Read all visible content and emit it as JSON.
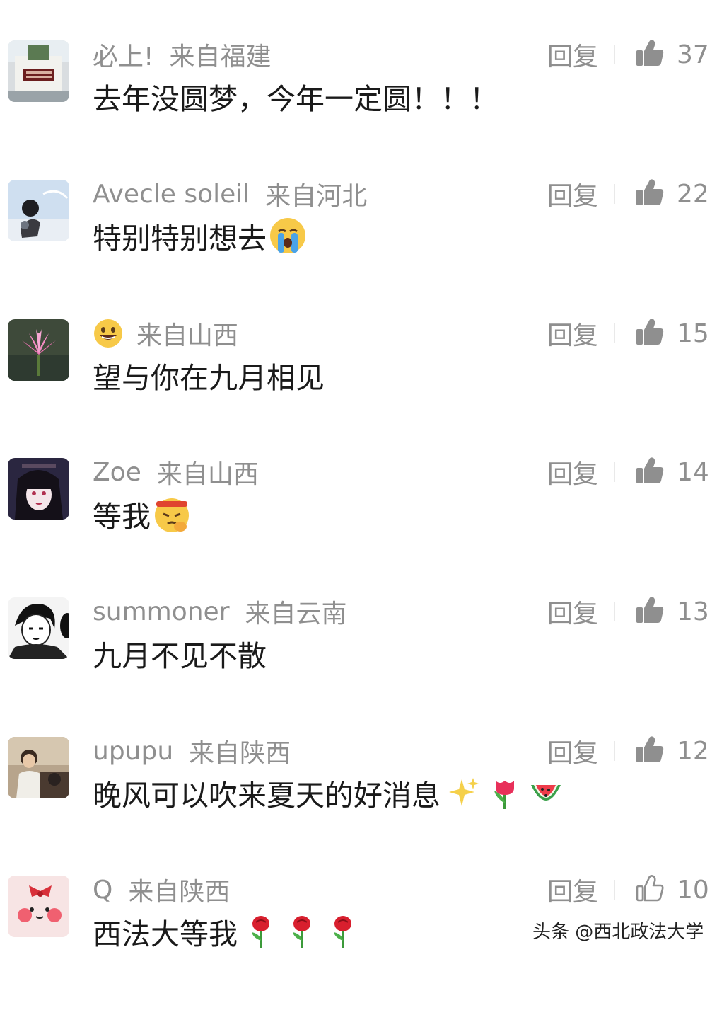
{
  "reply_label": "回复",
  "watermark": "头条 @西北政法大学",
  "comments": [
    {
      "user": "必上!",
      "location": "来自福建",
      "text": "去年没圆梦，今年一定圆！！！",
      "likes": "37",
      "avatar_icon": "building-photo-icon",
      "emojis": []
    },
    {
      "user": "Avecle soleil",
      "location": "来自河北",
      "text": "特别特别想去",
      "likes": "22",
      "avatar_icon": "sky-figure-photo-icon",
      "emojis": [
        "crying-face-emoji"
      ]
    },
    {
      "user": "",
      "location": "来自山西",
      "text": "望与你在九月相见",
      "likes": "15",
      "avatar_icon": "lotus-flower-photo-icon",
      "name_icon": "smiley-face-emoji",
      "emojis": []
    },
    {
      "user": "Zoe",
      "location": "来自山西",
      "text": "等我",
      "likes": "14",
      "avatar_icon": "anime-girl-avatar-icon",
      "emojis": [
        "determined-face-emoji"
      ]
    },
    {
      "user": "summoner",
      "location": "来自云南",
      "text": "九月不见不散",
      "likes": "13",
      "avatar_icon": "manga-boy-avatar-icon",
      "emojis": []
    },
    {
      "user": "upupu",
      "location": "来自陕西",
      "text": "晚风可以吹来夏天的好消息",
      "likes": "12",
      "avatar_icon": "person-photo-icon",
      "emojis": [
        "sparkles-emoji",
        "tulip-emoji",
        "watermelon-emoji"
      ]
    },
    {
      "user": "Q",
      "location": "来自陕西",
      "text": "西法大等我",
      "likes": "10",
      "avatar_icon": "cartoon-blush-face-icon",
      "emojis": [
        "rose-emoji",
        "rose-emoji",
        "rose-emoji"
      ],
      "liked": false
    }
  ]
}
